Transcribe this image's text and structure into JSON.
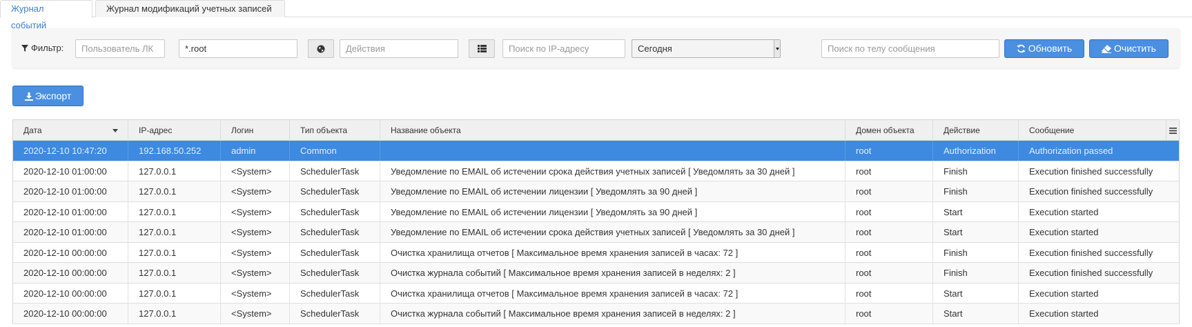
{
  "tabs": [
    {
      "label": "Журнал событий",
      "active": true
    },
    {
      "label": "Журнал модификаций учетных записей",
      "active": false
    }
  ],
  "filter": {
    "label": "Фильтр:",
    "user_placeholder": "Пользователь ЛК",
    "domain_value": "*.root",
    "actions_placeholder": "Действия",
    "ip_placeholder": "Поиск по IP-адресу",
    "period_value": "Сегодня",
    "message_placeholder": "Поиск по телу сообщения",
    "refresh_label": "Обновить",
    "clear_label": "Очистить"
  },
  "export_label": "Экспорт",
  "colors": {
    "accent": "#4a8fe0",
    "selected_row": "#3d8ae0"
  },
  "table": {
    "columns": [
      "Дата",
      "IP-адрес",
      "Логин",
      "Тип объекта",
      "Название объекта",
      "Домен объекта",
      "Действие",
      "Сообщение"
    ],
    "sorted_column": "Дата",
    "rows": [
      {
        "date": "2020-12-10 10:47:20",
        "ip": "192.168.50.252",
        "login": "admin",
        "type": "Common",
        "name": "",
        "domain": "root",
        "action": "Authorization",
        "message": "Authorization passed",
        "selected": true
      },
      {
        "date": "2020-12-10 01:00:00",
        "ip": "127.0.0.1",
        "login": "<System>",
        "type": "SchedulerTask",
        "name": "Уведомление по EMAIL об истечении срока действия учетных записей [ Уведомлять за 30 дней ]",
        "domain": "root",
        "action": "Finish",
        "message": "Execution finished successfully"
      },
      {
        "date": "2020-12-10 01:00:00",
        "ip": "127.0.0.1",
        "login": "<System>",
        "type": "SchedulerTask",
        "name": "Уведомление по EMAIL об истечении лицензии [ Уведомлять за 90 дней ]",
        "domain": "root",
        "action": "Finish",
        "message": "Execution finished successfully"
      },
      {
        "date": "2020-12-10 01:00:00",
        "ip": "127.0.0.1",
        "login": "<System>",
        "type": "SchedulerTask",
        "name": "Уведомление по EMAIL об истечении лицензии [ Уведомлять за 90 дней ]",
        "domain": "root",
        "action": "Start",
        "message": "Execution started"
      },
      {
        "date": "2020-12-10 01:00:00",
        "ip": "127.0.0.1",
        "login": "<System>",
        "type": "SchedulerTask",
        "name": "Уведомление по EMAIL об истечении срока действия учетных записей [ Уведомлять за 30 дней ]",
        "domain": "root",
        "action": "Start",
        "message": "Execution started"
      },
      {
        "date": "2020-12-10 00:00:00",
        "ip": "127.0.0.1",
        "login": "<System>",
        "type": "SchedulerTask",
        "name": "Очистка хранилища отчетов [ Максимальное время хранения записей в часах: 72 ]",
        "domain": "root",
        "action": "Finish",
        "message": "Execution finished successfully"
      },
      {
        "date": "2020-12-10 00:00:00",
        "ip": "127.0.0.1",
        "login": "<System>",
        "type": "SchedulerTask",
        "name": "Очистка журнала событий [ Максимальное время хранения записей в неделях: 2 ]",
        "domain": "root",
        "action": "Finish",
        "message": "Execution finished successfully"
      },
      {
        "date": "2020-12-10 00:00:00",
        "ip": "127.0.0.1",
        "login": "<System>",
        "type": "SchedulerTask",
        "name": "Очистка хранилища отчетов [ Максимальное время хранения записей в часах: 72 ]",
        "domain": "root",
        "action": "Start",
        "message": "Execution started"
      },
      {
        "date": "2020-12-10 00:00:00",
        "ip": "127.0.0.1",
        "login": "<System>",
        "type": "SchedulerTask",
        "name": "Очистка журнала событий [ Максимальное время хранения записей в неделях: 2 ]",
        "domain": "root",
        "action": "Start",
        "message": "Execution started"
      }
    ]
  }
}
